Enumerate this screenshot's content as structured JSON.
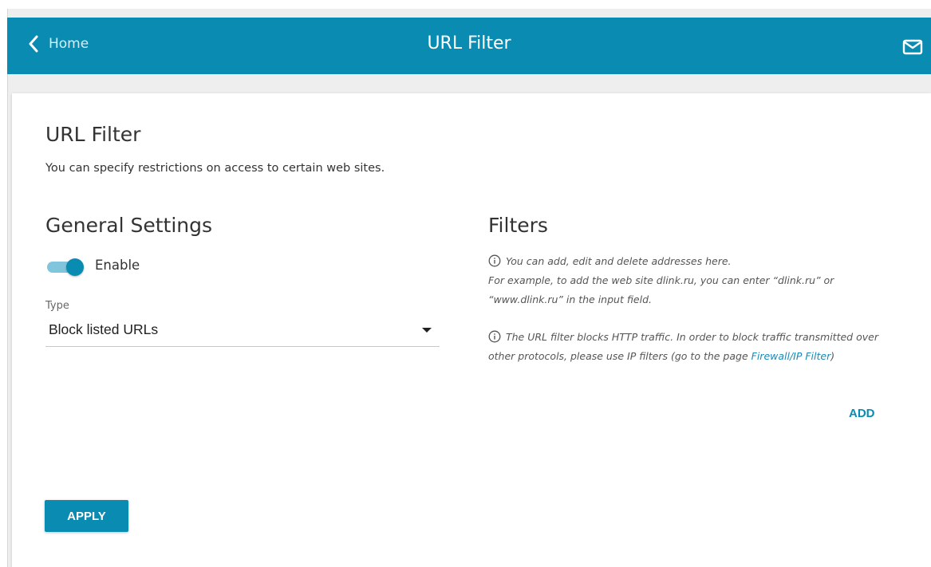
{
  "header": {
    "back_label": "Home",
    "title": "URL Filter",
    "back_icon": "chevron-left-icon",
    "mail_icon": "mail-icon"
  },
  "page": {
    "heading": "URL Filter",
    "description": "You can specify restrictions on access to certain web sites."
  },
  "general": {
    "heading": "General Settings",
    "enable_label": "Enable",
    "enabled": true,
    "type_label": "Type",
    "type_value": "Block listed URLs"
  },
  "filters": {
    "heading": "Filters",
    "info1_line1": "You can add, edit and delete addresses here.",
    "info1_line2": "For example, to add the web site dlink.ru, you can enter “dlink.ru” or",
    "info1_line3": "“www.dlink.ru” in the input field.",
    "info2_line1": "The URL filter blocks HTTP traffic. In order to block traffic transmitted over",
    "info2_line2_prefix": "other protocols, please use IP filters (go to the page ",
    "info2_link": "Firewall/IP Filter",
    "info2_line2_suffix": ")",
    "add_label": "ADD"
  },
  "actions": {
    "apply_label": "APPLY"
  },
  "colors": {
    "accent": "#0a8bb2",
    "toggle_track": "#7fc6dc",
    "link": "#1a8ab4"
  }
}
